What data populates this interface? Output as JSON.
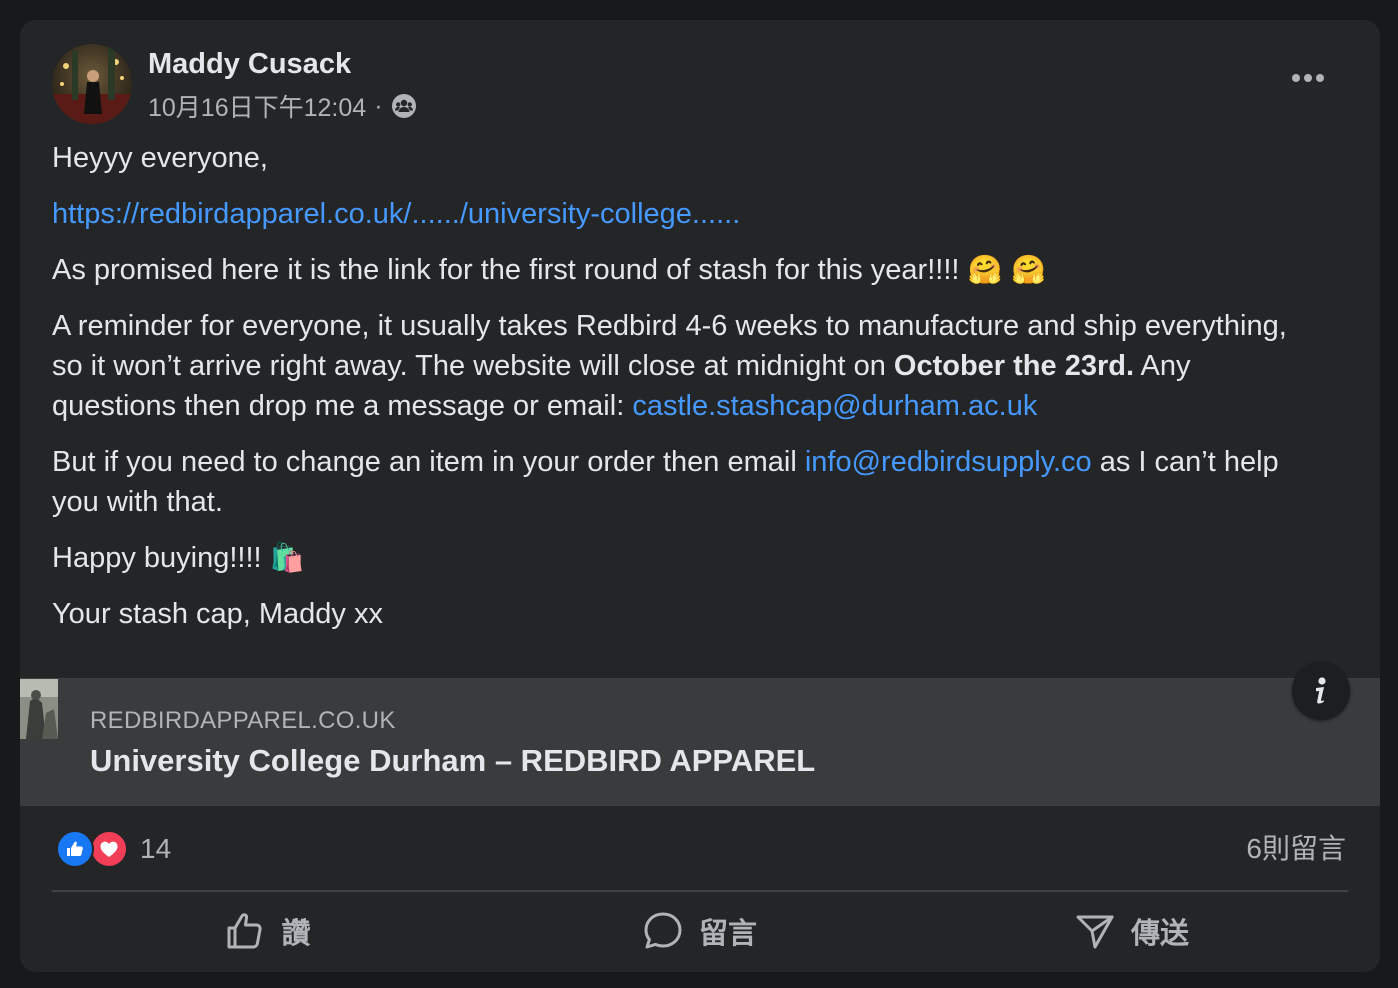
{
  "post": {
    "author": "Maddy Cusack",
    "timestamp": "10月16日下午12:04",
    "separator": "·",
    "audience_icon": "group-icon",
    "more_icon": "more-options-icon"
  },
  "body": {
    "greeting": "Heyyy everyone,",
    "url": "https://redbirdapparel.co.uk/....../university-college......",
    "promise_text": "As promised here it is the link for the first round of stash for this year!!!!",
    "promise_emojis": "🤗 🤗",
    "reminder_part1": "A reminder for everyone, it usually takes Redbird 4-6 weeks to manufacture and ship everything, so it won’t arrive right away. The website will close at midnight on ",
    "reminder_bold": "October the 23rd.",
    "reminder_part2": " Any questions then drop me a message or email: ",
    "email_1": "castle.stashcap@durham.ac.uk",
    "change_part1": "But if you need to change an item in your order then email ",
    "email_2": "info@redbirdsupply.co",
    "change_part2": " as I can’t help you with that.",
    "happy": "Happy buying!!!!",
    "happy_emoji": "🛍️",
    "signoff": "Your stash cap, Maddy xx"
  },
  "preview": {
    "domain": "REDBIRDAPPAREL.CO.UK",
    "title": "University College Durham – REDBIRD APPAREL",
    "info_icon": "info-icon"
  },
  "reactions": {
    "types": [
      "like",
      "love"
    ],
    "count": "14",
    "comments": "6則留言"
  },
  "actions": {
    "like": "讚",
    "comment": "留言",
    "share": "傳送"
  },
  "colors": {
    "card_bg": "#242526",
    "link": "#4599ff",
    "like_blue": "#1877f2",
    "love_red": "#f33e58"
  }
}
